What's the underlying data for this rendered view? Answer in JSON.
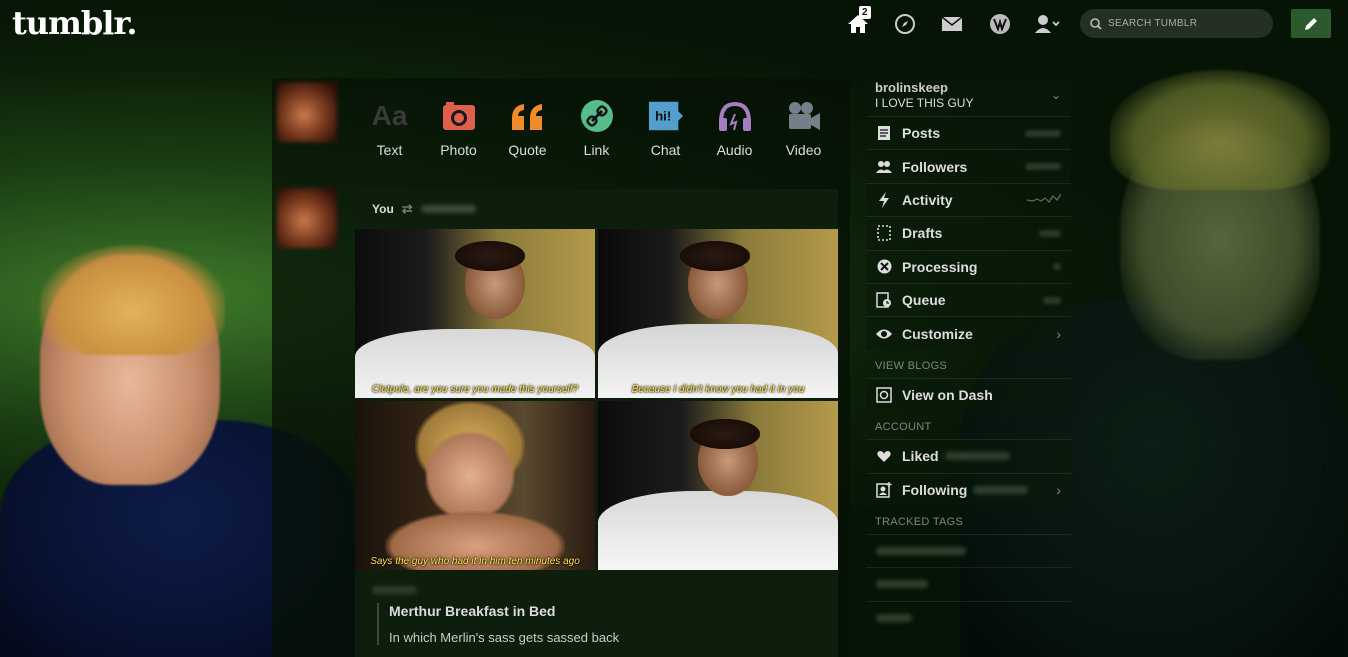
{
  "header": {
    "logo": "tumblr.",
    "home_badge": "2",
    "search_placeholder": "SEARCH TUMBLR",
    "icons": [
      "home-icon",
      "explore-icon",
      "mail-icon",
      "activity-icon",
      "account-icon",
      "compose-icon"
    ]
  },
  "post_types": [
    {
      "label": "Text",
      "icon": "text-icon",
      "color": "#3a3a3a",
      "glyph": "Aa"
    },
    {
      "label": "Photo",
      "icon": "camera-icon",
      "color": "#e05f4c",
      "glyph": "◉"
    },
    {
      "label": "Quote",
      "icon": "quote-icon",
      "color": "#f18a2a",
      "glyph": "❝"
    },
    {
      "label": "Link",
      "icon": "link-icon",
      "color": "#56bc8a",
      "glyph": "∞"
    },
    {
      "label": "Chat",
      "icon": "chat-icon",
      "color": "#529ecc",
      "glyph": "hi!"
    },
    {
      "label": "Audio",
      "icon": "headphones-icon",
      "color": "#a77dc2",
      "glyph": "♫"
    },
    {
      "label": "Video",
      "icon": "video-icon",
      "color": "#748089",
      "glyph": "▶"
    }
  ],
  "post": {
    "author": "You",
    "title": "Merthur Breakfast in Bed",
    "description": "In which Merlin's sass gets sassed back",
    "captions": [
      "Clotpole, are you sure you made this yourself?",
      "Because I didn't know you had it in you",
      "Says the guy who had it in him ten minutes ago",
      ""
    ]
  },
  "sidebar": {
    "blog_name": "brolinskeep",
    "blog_title": "I LOVE THIS GUY",
    "items": [
      {
        "label": "Posts",
        "icon": "posts-icon"
      },
      {
        "label": "Followers",
        "icon": "followers-icon"
      },
      {
        "label": "Activity",
        "icon": "lightning-icon"
      },
      {
        "label": "Drafts",
        "icon": "drafts-icon"
      },
      {
        "label": "Processing",
        "icon": "processing-icon"
      },
      {
        "label": "Queue",
        "icon": "queue-icon"
      },
      {
        "label": "Customize",
        "icon": "eye-icon"
      }
    ],
    "view_blogs_heading": "VIEW BLOGS",
    "view_on_dash": "View on Dash",
    "account_heading": "ACCOUNT",
    "liked": "Liked",
    "following": "Following",
    "tracked_tags_heading": "TRACKED TAGS"
  },
  "colors": {
    "accent_green": "#2d5a2d",
    "text_muted": "#7a8a7a",
    "caption_yellow": "#ffe34a"
  }
}
